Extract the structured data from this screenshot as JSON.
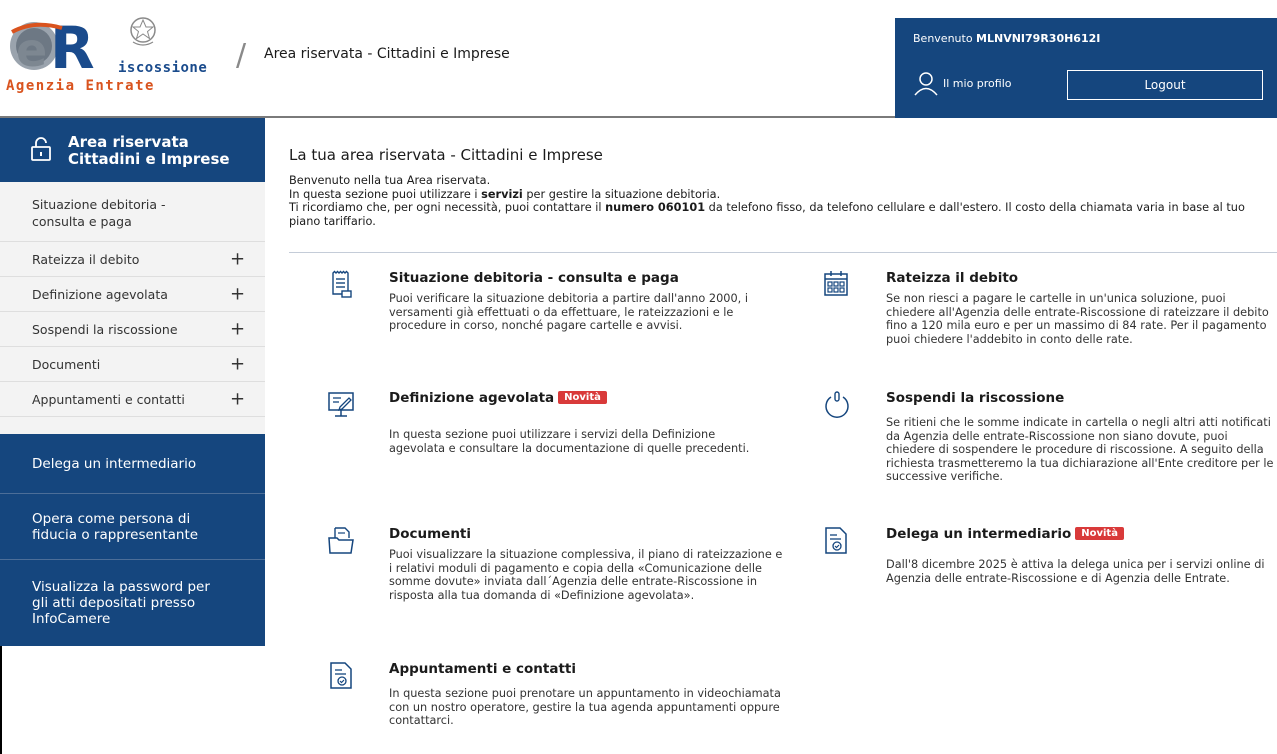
{
  "header": {
    "logo_riscossione": "iscossione",
    "logo_agenzia_a": "Agenzia ",
    "logo_agenzia_b": "Entrate",
    "title": "Area riservata - Cittadini e Imprese",
    "welcome_prefix": "Benvenuto ",
    "user_code": "MLNVNI79R30H612I",
    "profile_label": "Il mio profilo",
    "logout_label": "Logout"
  },
  "sidebar": {
    "title_line1": "Area riservata",
    "title_line2": "Cittadini e Imprese",
    "items": [
      {
        "label": "Situazione debitoria - consulta e paga"
      },
      {
        "label": "Rateizza il debito",
        "expand": "+"
      },
      {
        "label": "Definizione agevolata",
        "expand": "+"
      },
      {
        "label": "Sospendi la riscossione",
        "expand": "+"
      },
      {
        "label": "Documenti",
        "expand": "+"
      },
      {
        "label": "Appuntamenti e contatti",
        "expand": "+"
      }
    ],
    "links": [
      {
        "label": "Delega un intermediario"
      },
      {
        "label": "Opera come persona di fiducia o rappresentante"
      },
      {
        "label": "Visualizza la password per gli atti depositati presso InfoCamere"
      }
    ]
  },
  "main": {
    "heading": "La tua area riservata - Cittadini e Imprese",
    "intro_line1": "Benvenuto nella tua Area riservata.",
    "intro_line2a": "In questa sezione puoi utilizzare i ",
    "intro_line2b": "servizi",
    "intro_line2c": " per gestire la situazione debitoria.",
    "intro_line3a": "Ti ricordiamo che, per ogni necessità, puoi contattare il ",
    "intro_line3b": "numero 060101",
    "intro_line3c": " da telefono fisso, da telefono cellulare e dall'estero. Il costo della chiamata varia in base al tuo piano tariffario.",
    "badge_label": "Novità",
    "cards": [
      {
        "title": "Situazione debitoria - consulta e paga",
        "desc": "Puoi verificare la situazione debitoria a partire dall'anno 2000, i versamenti già effettuati o da effettuare, le rateizzazioni e le procedure in corso, nonché pagare cartelle e avvisi.",
        "icon": "document-list-icon"
      },
      {
        "title": "Rateizza il debito",
        "desc": "Se non riesci a pagare le cartelle in un'unica soluzione, puoi chiedere all'Agenzia delle entrate-Riscossione di rateizzare il debito fino a 120 mila euro e per un massimo di 84 rate. Per il pagamento puoi chiedere l'addebito in conto delle rate.",
        "icon": "calendar-icon"
      },
      {
        "title": "Definizione agevolata",
        "desc": "In questa sezione puoi utilizzare i servizi della Definizione agevolata e consultare la documentazione di quelle precedenti.",
        "icon": "monitor-icon"
      },
      {
        "title": "Sospendi la riscossione",
        "desc": "Se ritieni che le somme indicate in cartella o negli altri atti notificati da Agenzia delle entrate-Riscossione non siano dovute, puoi chiedere di sospendere le procedure di riscossione. A seguito della richiesta trasmetteremo la tua dichiarazione all'Ente creditore per le successive verifiche.",
        "icon": "power-icon"
      },
      {
        "title": "Documenti",
        "desc": "Puoi visualizzare la situazione complessiva, il piano di rateizzazione e i relativi moduli di pagamento e copia della «Comunicazione delle somme dovute» inviata dall´Agenzia delle entrate-Riscossione in risposta alla tua domanda di «Definizione agevolata».",
        "icon": "folder-icon"
      },
      {
        "title": "Delega un intermediario",
        "desc": "Dall'8 dicembre 2025 è attiva la delega unica per i servizi online di Agenzia delle entrate-Riscossione e di Agenzia delle Entrate.",
        "icon": "document-check-icon"
      },
      {
        "title": "Appuntamenti e contatti",
        "desc": "In questa sezione puoi prenotare un appuntamento in videochiamata con un nostro operatore, gestire la tua agenda appuntamenti oppure contattarci.",
        "icon": "document-check-icon"
      }
    ]
  },
  "colors": {
    "primary": "#15467e",
    "badge": "#d93a3a",
    "logo_orange": "#d9531e"
  }
}
